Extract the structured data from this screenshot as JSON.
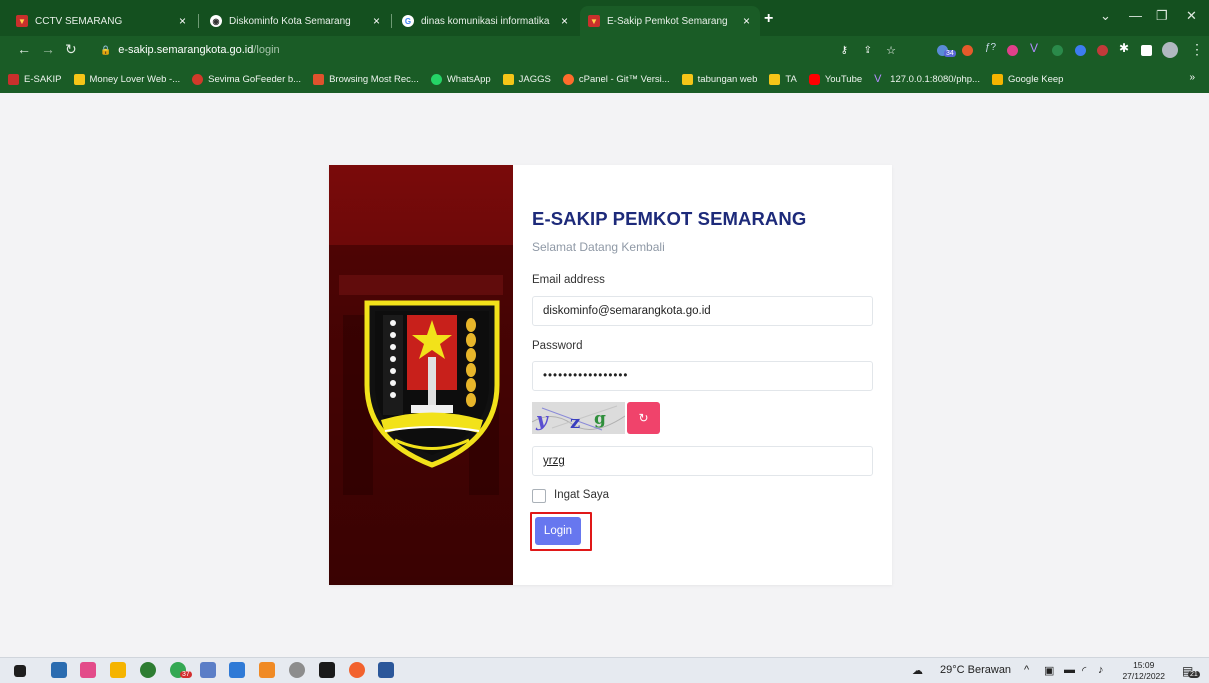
{
  "browser": {
    "tabs": [
      {
        "label": "CCTV SEMARANG",
        "active": false
      },
      {
        "label": "Diskominfo Kota Semarang",
        "active": false
      },
      {
        "label": "dinas komunikasi informatika sta",
        "active": false
      },
      {
        "label": "E-Sakip Pemkot Semarang",
        "active": true
      }
    ],
    "url_host": "e-sakip.semarangkota.go.id",
    "url_path": "/login",
    "bookmarks": [
      "E-SAKIP",
      "Money Lover Web -...",
      "Sevima GoFeeder b...",
      "Browsing Most Rec...",
      "WhatsApp",
      "JAGGS",
      "cPanel - Git™ Versi...",
      "tabungan web",
      "TA",
      "YouTube",
      "127.0.0.1:8080/php...",
      "Google Keep"
    ],
    "extension_badge": "34"
  },
  "login": {
    "title": "E-SAKIP PEMKOT SEMARANG",
    "subtitle": "Selamat Datang Kembali",
    "email_label": "Email address",
    "email_value": "diskominfo@semarangkota.go.id",
    "password_label": "Password",
    "password_value": "•••••••••••••••••",
    "captcha_text": "yzg",
    "captcha_input": "yrzg",
    "remember_label": "Ingat Saya",
    "remember_checked": false,
    "login_label": "Login"
  },
  "taskbar": {
    "weather": "29°C  Berawan",
    "time": "15:09",
    "date": "27/12/2022",
    "notification_count": "21",
    "badge_37": "37"
  },
  "colors": {
    "chrome_green": "#1a5c26",
    "title_navy": "#1d2a7a",
    "primary_button": "#6777ef",
    "refresh_pink": "#f0436b",
    "highlight_red": "#e01818"
  }
}
